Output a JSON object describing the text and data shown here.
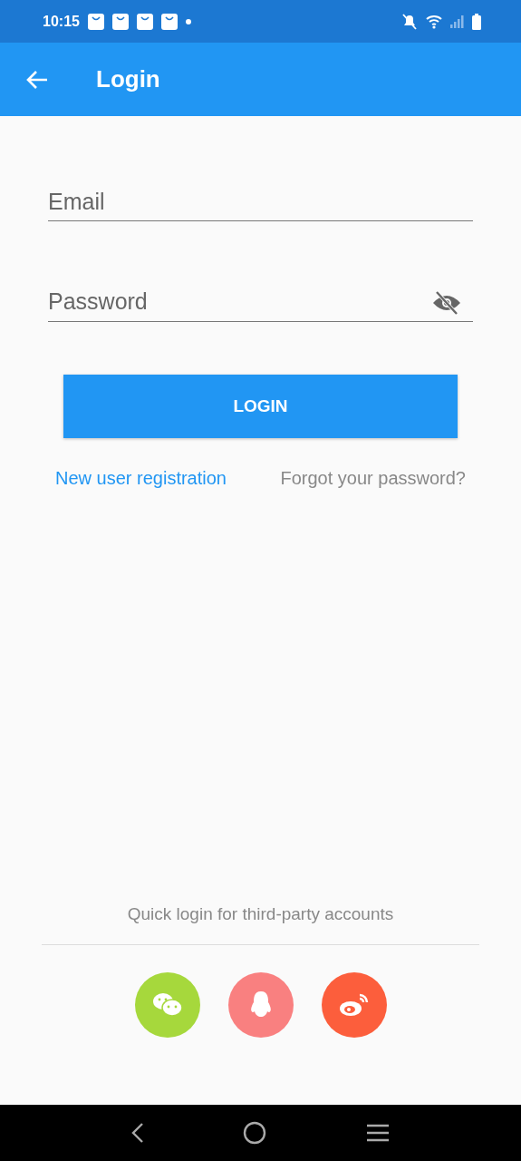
{
  "status_bar": {
    "time": "10:15"
  },
  "app_bar": {
    "title": "Login"
  },
  "email_field": {
    "placeholder": "Email"
  },
  "password_field": {
    "placeholder": "Password",
    "visible": false
  },
  "login_button": {
    "label": "LOGIN"
  },
  "links": [
    {
      "kind": "primary",
      "label": "New user registration"
    },
    {
      "kind": "secondary",
      "label": "Forgot your password?"
    }
  ],
  "third_party": {
    "caption": "Quick login for third-party accounts",
    "accounts": [
      {
        "kind": "chat",
        "color": "#a6d83c"
      },
      {
        "kind": "penguin",
        "color": "#f98080"
      },
      {
        "kind": "weibo",
        "color": "#fc5e3c"
      }
    ]
  }
}
